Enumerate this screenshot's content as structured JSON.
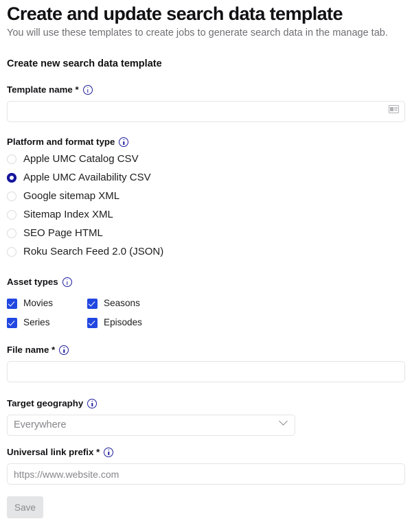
{
  "header": {
    "title": "Create and update search data template",
    "subtitle": "You will use these templates to create jobs to generate search data in the manage tab.",
    "section_title": "Create new search data template"
  },
  "fields": {
    "template_name": {
      "label": "Template name *",
      "value": "",
      "placeholder": "",
      "trailing_icon": "contact-card-icon"
    },
    "platform_format_type": {
      "label": "Platform and format type",
      "selected": "Apple UMC Availability CSV",
      "options": [
        "Apple UMC Catalog CSV",
        "Apple UMC Availability CSV",
        "Google sitemap XML",
        "Sitemap Index XML",
        "SEO Page HTML",
        "Roku Search Feed 2.0 (JSON)"
      ]
    },
    "asset_types": {
      "label": "Asset types",
      "options": [
        {
          "label": "Movies",
          "checked": true
        },
        {
          "label": "Seasons",
          "checked": true
        },
        {
          "label": "Series",
          "checked": true
        },
        {
          "label": "Episodes",
          "checked": true
        }
      ]
    },
    "file_name": {
      "label": "File name *",
      "value": "",
      "placeholder": ""
    },
    "target_geography": {
      "label": "Target geography",
      "selected": "Everywhere"
    },
    "universal_link_prefix": {
      "label": "Universal link prefix *",
      "value": "",
      "placeholder": "https://www.website.com"
    }
  },
  "actions": {
    "save_label": "Save",
    "save_disabled": true
  },
  "icons": {
    "info": "info-icon",
    "chevron_down": "chevron-down-icon"
  },
  "colors": {
    "accent_checkbox": "#2147e0",
    "accent_radio": "#16169e",
    "info_icon": "#1c1c9c",
    "text_primary": "#1d1d1f",
    "text_muted": "#6e6e73",
    "placeholder": "#86868b",
    "border": "#e4e4e7",
    "save_bg": "#e4e5e7",
    "save_text": "#8b8b90"
  }
}
